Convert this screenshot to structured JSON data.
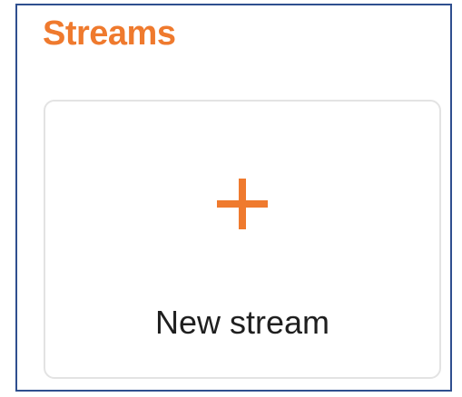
{
  "section": {
    "title": "Streams"
  },
  "new_stream_card": {
    "label": "New stream",
    "icon": "plus-icon"
  },
  "colors": {
    "accent": "#ef7a2e",
    "frame_border": "#2f4f8f",
    "card_border": "#e3e3e3",
    "label_text": "#1f1f1f"
  }
}
